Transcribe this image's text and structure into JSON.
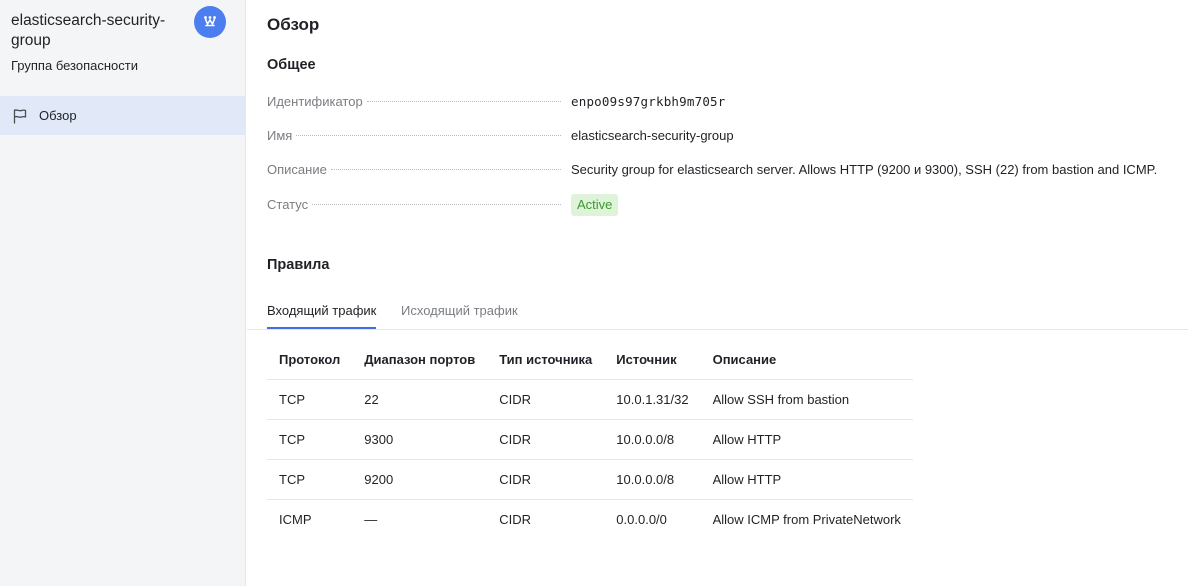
{
  "sidebar": {
    "title": "elasticsearch-security-group",
    "subtitle": "Группа безопасности",
    "service_icon": "vpc-network-icon",
    "items": [
      {
        "label": "Обзор",
        "icon": "flag-icon",
        "active": true
      }
    ]
  },
  "main": {
    "title": "Обзор",
    "general": {
      "title": "Общее",
      "props": [
        {
          "key": "Идентификатор",
          "value": "enpo09s97grkbh9m705r"
        },
        {
          "key": "Имя",
          "value": "elasticsearch-security-group"
        },
        {
          "key": "Описание",
          "value": "Security group for elasticsearch server. Allows HTTP (9200 и 9300), SSH (22) from bastion and ICMP."
        },
        {
          "key": "Статус",
          "value": "Active"
        }
      ]
    },
    "rules": {
      "title": "Правила",
      "tabs": [
        {
          "label": "Входящий трафик",
          "active": true
        },
        {
          "label": "Исходящий трафик",
          "active": false
        }
      ],
      "columns": [
        "Протокол",
        "Диапазон портов",
        "Тип источника",
        "Источник",
        "Описание"
      ],
      "rows": [
        [
          "TCP",
          "22",
          "CIDR",
          "10.0.1.31/32",
          "Allow SSH from bastion"
        ],
        [
          "TCP",
          "9300",
          "CIDR",
          "10.0.0.0/8",
          "Allow HTTP"
        ],
        [
          "TCP",
          "9200",
          "CIDR",
          "10.0.0.0/8",
          "Allow HTTP"
        ],
        [
          "ICMP",
          "—",
          "CIDR",
          "0.0.0.0/0",
          "Allow ICMP from PrivateNetwork"
        ]
      ]
    }
  },
  "colors": {
    "accent": "#3f6ee6",
    "service_icon_bg": "#4d7ef0",
    "active_item_bg": "#e1e8f8",
    "status_active_bg": "#def3d9",
    "status_active_text": "#3a9b2f"
  }
}
